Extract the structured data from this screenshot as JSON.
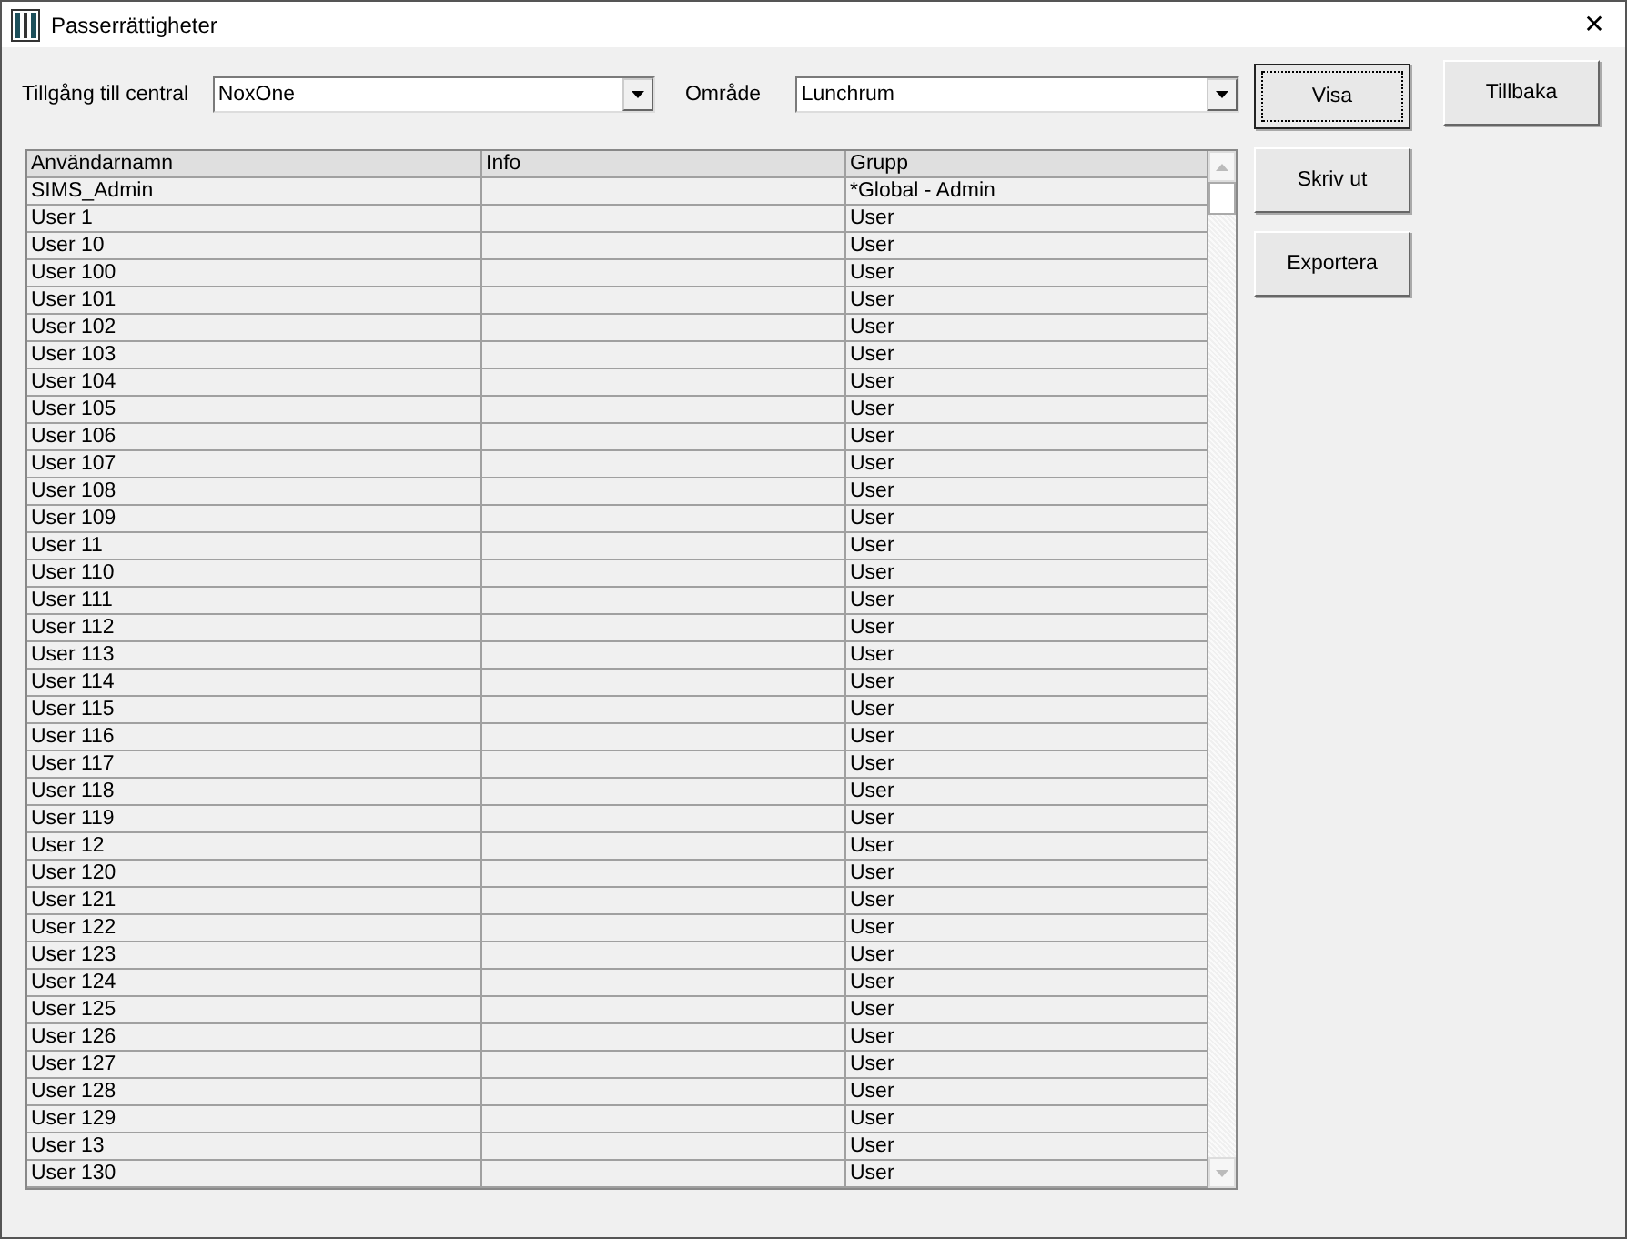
{
  "window": {
    "title": "Passerrättigheter",
    "close": "✕"
  },
  "filters": [
    {
      "label": "Tillgång till central",
      "value": "NoxOne"
    },
    {
      "label": "Område",
      "value": "Lunchrum"
    }
  ],
  "buttons": [
    {
      "label": "Visa",
      "focused": true
    },
    {
      "label": "Tillbaka",
      "focused": false
    },
    {
      "label": "Skriv ut",
      "focused": false
    },
    {
      "label": "Exportera",
      "focused": false
    }
  ],
  "table": {
    "columns": [
      "Användarnamn",
      "Info",
      "Grupp"
    ],
    "rows": [
      {
        "name": "SIMS_Admin",
        "group": "*Global - Admin"
      },
      {
        "name": "User 1",
        "group": "User"
      },
      {
        "name": "User 10",
        "group": "User"
      },
      {
        "name": "User 100",
        "group": "User"
      },
      {
        "name": "User 101",
        "group": "User"
      },
      {
        "name": "User 102",
        "group": "User"
      },
      {
        "name": "User 103",
        "group": "User"
      },
      {
        "name": "User 104",
        "group": "User"
      },
      {
        "name": "User 105",
        "group": "User"
      },
      {
        "name": "User 106",
        "group": "User"
      },
      {
        "name": "User 107",
        "group": "User"
      },
      {
        "name": "User 108",
        "group": "User"
      },
      {
        "name": "User 109",
        "group": "User"
      },
      {
        "name": "User 11",
        "group": "User"
      },
      {
        "name": "User 110",
        "group": "User"
      },
      {
        "name": "User 111",
        "group": "User"
      },
      {
        "name": "User 112",
        "group": "User"
      },
      {
        "name": "User 113",
        "group": "User"
      },
      {
        "name": "User 114",
        "group": "User"
      },
      {
        "name": "User 115",
        "group": "User"
      },
      {
        "name": "User 116",
        "group": "User"
      },
      {
        "name": "User 117",
        "group": "User"
      },
      {
        "name": "User 118",
        "group": "User"
      },
      {
        "name": "User 119",
        "group": "User"
      },
      {
        "name": "User 12",
        "group": "User"
      },
      {
        "name": "User 120",
        "group": "User"
      },
      {
        "name": "User 121",
        "group": "User"
      },
      {
        "name": "User 122",
        "group": "User"
      },
      {
        "name": "User 123",
        "group": "User"
      },
      {
        "name": "User 124",
        "group": "User"
      },
      {
        "name": "User 125",
        "group": "User"
      },
      {
        "name": "User 126",
        "group": "User"
      },
      {
        "name": "User 127",
        "group": "User"
      },
      {
        "name": "User 128",
        "group": "User"
      },
      {
        "name": "User 129",
        "group": "User"
      },
      {
        "name": "User 13",
        "group": "User"
      },
      {
        "name": "User 130",
        "group": "User"
      }
    ]
  }
}
